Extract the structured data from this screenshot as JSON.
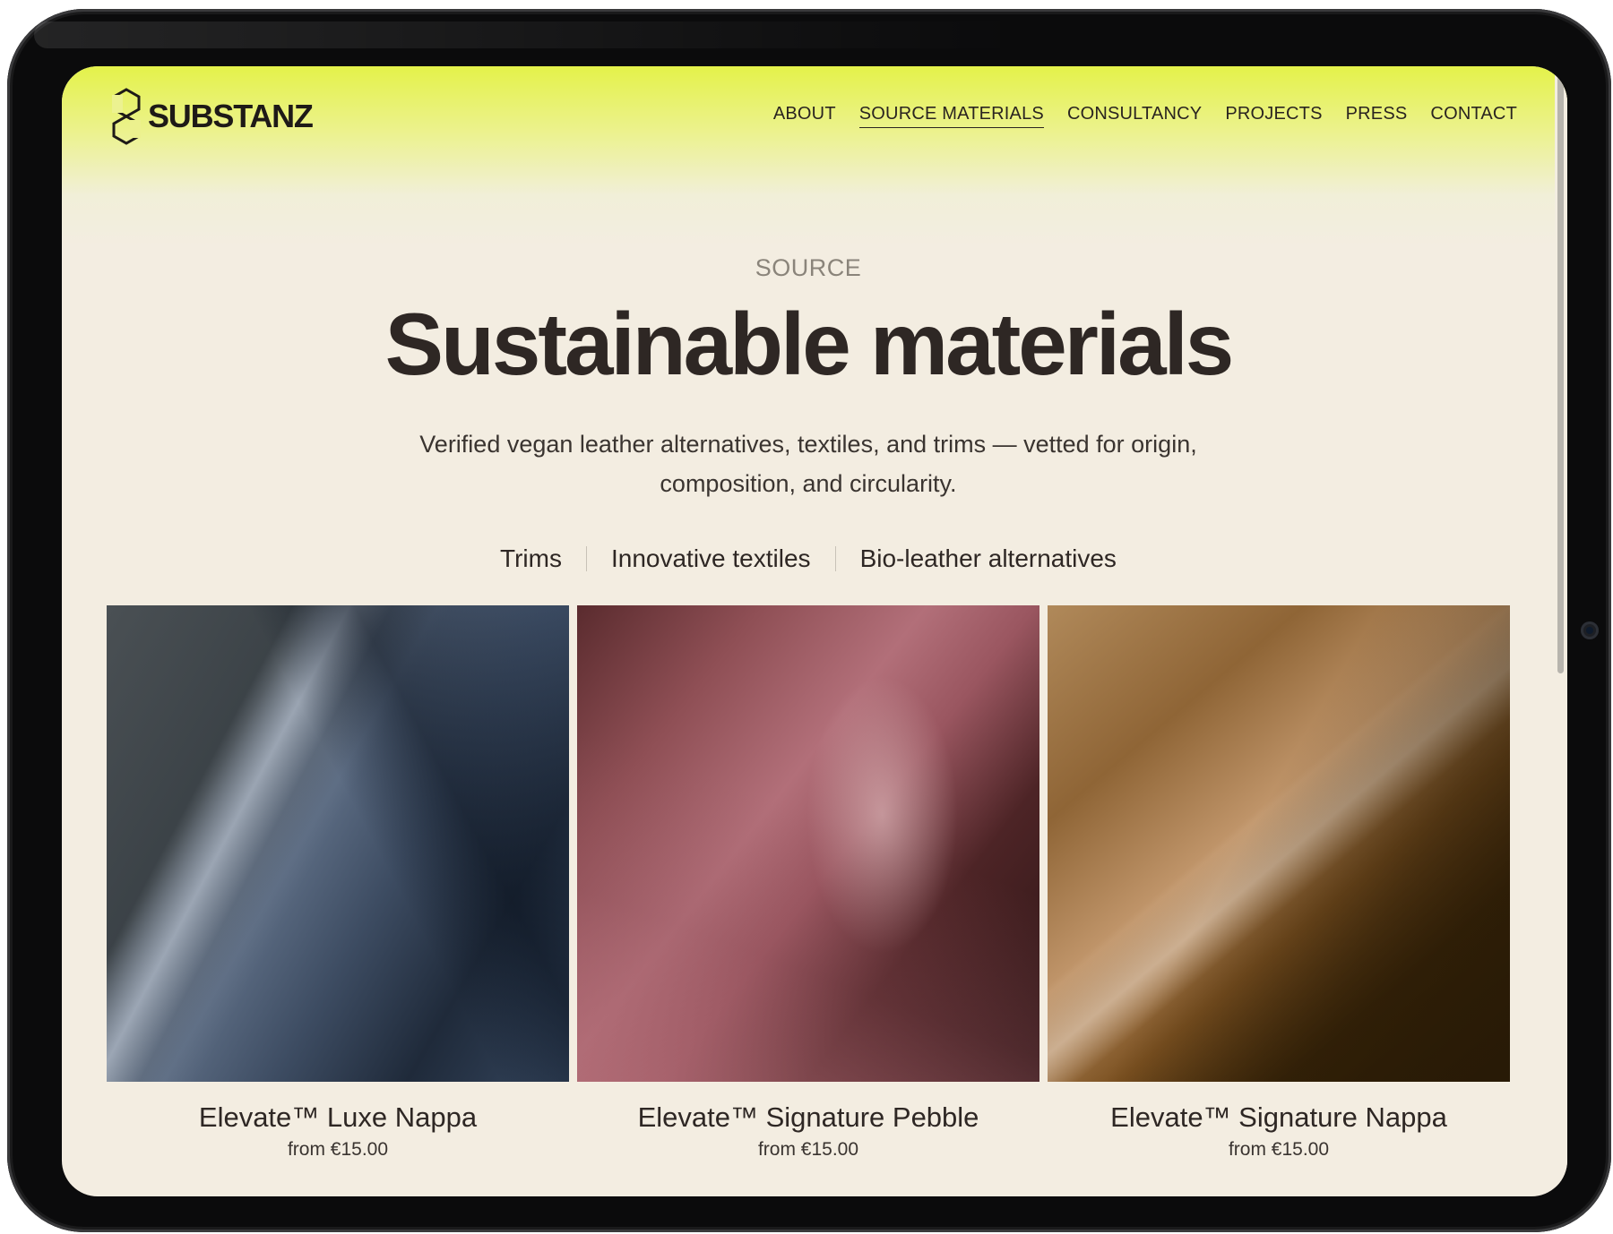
{
  "brand": {
    "name": "SUBSTANZ",
    "logo_icon": "hexagon-s-logo-icon"
  },
  "nav": {
    "items": [
      {
        "label": "ABOUT",
        "active": false
      },
      {
        "label": "SOURCE MATERIALS",
        "active": true
      },
      {
        "label": "CONSULTANCY",
        "active": false
      },
      {
        "label": "PROJECTS",
        "active": false
      },
      {
        "label": "PRESS",
        "active": false
      },
      {
        "label": "CONTACT",
        "active": false
      }
    ]
  },
  "hero": {
    "eyebrow": "SOURCE",
    "title": "Sustainable materials",
    "subtitle": "Verified vegan leather alternatives, textiles, and trims — vetted for origin, composition, and circularity."
  },
  "categories": [
    {
      "label": "Trims"
    },
    {
      "label": "Innovative textiles"
    },
    {
      "label": "Bio-leather alternatives"
    }
  ],
  "products": [
    {
      "name": "Elevate™ Luxe Nappa",
      "price": "from €15.00",
      "swatch_color": "#3d4c62"
    },
    {
      "name": "Elevate™ Signature Pebble",
      "price": "from €15.00",
      "swatch_color": "#9a5660"
    },
    {
      "name": "Elevate™ Signature Nappa",
      "price": "from €15.00",
      "swatch_color": "#8f6536"
    }
  ],
  "colors": {
    "accent": "#e4f24a",
    "background": "#f3ede1",
    "text": "#2e2724",
    "device": "#0b0b0c"
  }
}
